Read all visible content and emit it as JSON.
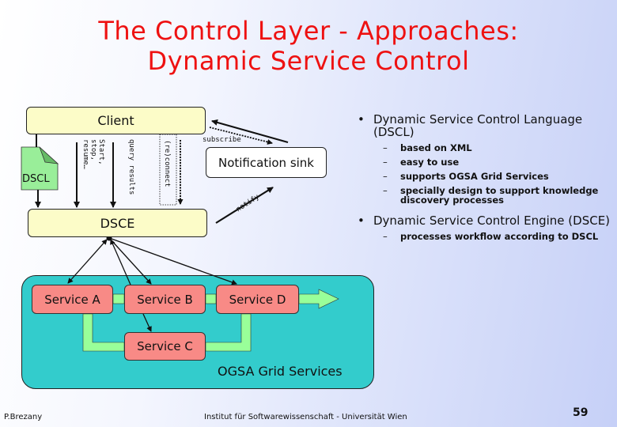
{
  "slide": {
    "title_line1": "The Control Layer - Approaches:",
    "title_line2": "Dynamic Service Control",
    "colors": {
      "title": "#ee1111",
      "component_box": "#fcfcc8",
      "service_box": "#f88a86",
      "grid_container": "#33cccc",
      "flow_arrow": "#99ff99",
      "document": "#99ee99"
    }
  },
  "diagram": {
    "client_label": "Client",
    "dsce_label": "DSCE",
    "dscl_doc_label": "DSCL",
    "notification_sink_label": "Notification sink",
    "edge_labels": {
      "start_stop_resume": "Start,\nstop,\nresume…",
      "query_results": "query results",
      "reconnect": "(re)connect",
      "subscribe": "subscribe",
      "notify": "notify"
    },
    "services": {
      "a": "Service A",
      "b": "Service B",
      "c": "Service C",
      "d": "Service D"
    },
    "grid_label": "OGSA Grid Services"
  },
  "bullets": [
    {
      "marker": "•",
      "text": "Dynamic Service Control Language (DSCL)",
      "sub": [
        "based on XML",
        "easy to use",
        "supports OGSA Grid Services",
        "specially design to support knowledge discovery processes"
      ]
    },
    {
      "marker": "•",
      "text": "Dynamic Service Control Engine (DSCE)",
      "sub": [
        "processes workflow according to DSCL"
      ]
    }
  ],
  "footer": {
    "author": "P.Brezany",
    "institute": "Institut für Softwarewissenschaft - Universität Wien",
    "page_number": "59"
  }
}
